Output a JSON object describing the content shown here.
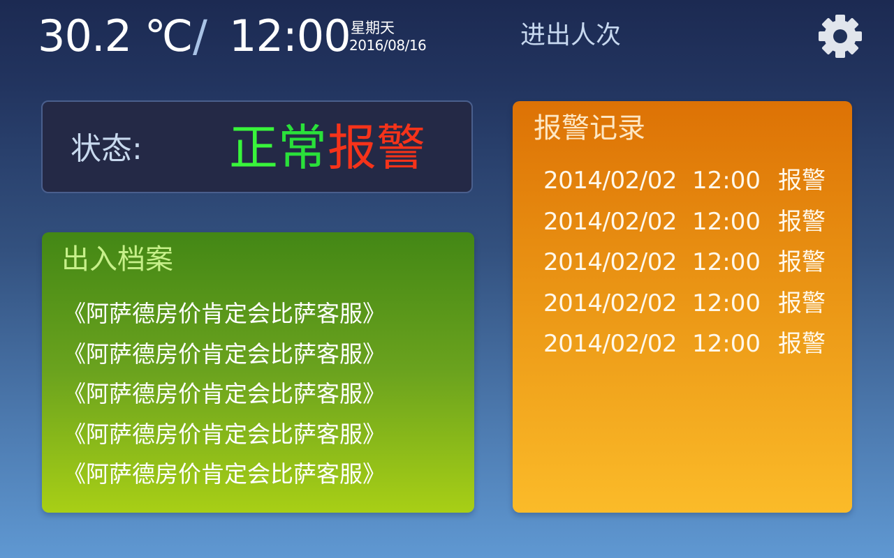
{
  "header": {
    "temperature": "30.2 ℃",
    "divider": "/",
    "time": "12:00",
    "weekday": "星期天",
    "date": "2016/08/16",
    "people_count_label": "进出人次",
    "settings_icon": "gear-icon"
  },
  "status": {
    "label": "状态:",
    "normal_char_1": "正",
    "normal_char_2": "常",
    "alarm": "报警",
    "normal_color": "#39f53b",
    "alarm_color": "#f5331a"
  },
  "archive": {
    "title": "出入档案",
    "items": [
      "《阿萨德房价肯定会比萨客服》",
      "《阿萨德房价肯定会比萨客服》",
      "《阿萨德房价肯定会比萨客服》",
      "《阿萨德房价肯定会比萨客服》",
      "《阿萨德房价肯定会比萨客服》"
    ],
    "color_top": "#438715",
    "color_bottom": "#a8cf16"
  },
  "alarm_log": {
    "title": "报警记录",
    "records": [
      {
        "date": "2014/02/02",
        "time": "12:00",
        "type": "报警"
      },
      {
        "date": "2014/02/02",
        "time": "12:00",
        "type": "报警"
      },
      {
        "date": "2014/02/02",
        "time": "12:00",
        "type": "报警"
      },
      {
        "date": "2014/02/02",
        "time": "12:00",
        "type": "报警"
      },
      {
        "date": "2014/02/02",
        "time": "12:00",
        "type": "报警"
      }
    ],
    "color_top": "#dd7205",
    "color_bottom": "#fbbb29"
  }
}
